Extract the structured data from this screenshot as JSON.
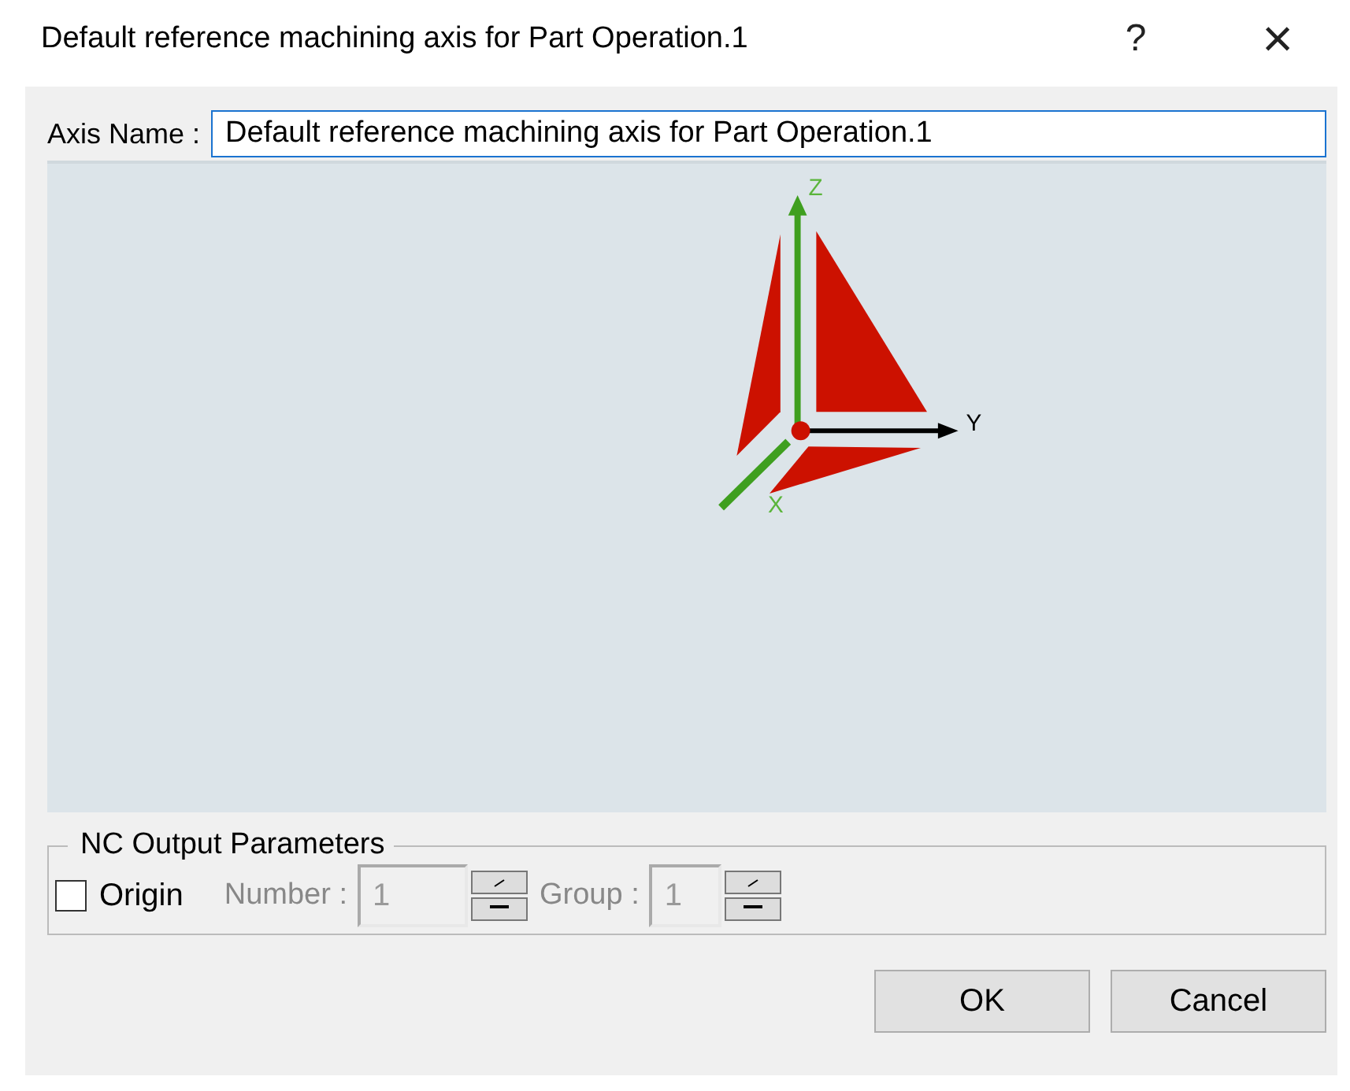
{
  "window": {
    "title": "Default reference machining axis for Part Operation.1",
    "help": "?",
    "close": "×"
  },
  "axis_name": {
    "label": "Axis Name :",
    "value": "Default reference machining axis for Part Operation.1"
  },
  "viewer": {
    "axes": [
      {
        "kind": "z",
        "label": "Z"
      },
      {
        "kind": "y",
        "label": "Y"
      },
      {
        "kind": "x",
        "label": "X"
      }
    ]
  },
  "nc_output": {
    "title": "NC Output Parameters",
    "origin": {
      "label": "Origin",
      "checked": false
    },
    "fields": [
      {
        "label": "Number :",
        "value": "1",
        "disabled": true
      },
      {
        "label": "Group :",
        "value": "1",
        "disabled": true
      }
    ]
  },
  "buttons": [
    "OK",
    "Cancel"
  ]
}
